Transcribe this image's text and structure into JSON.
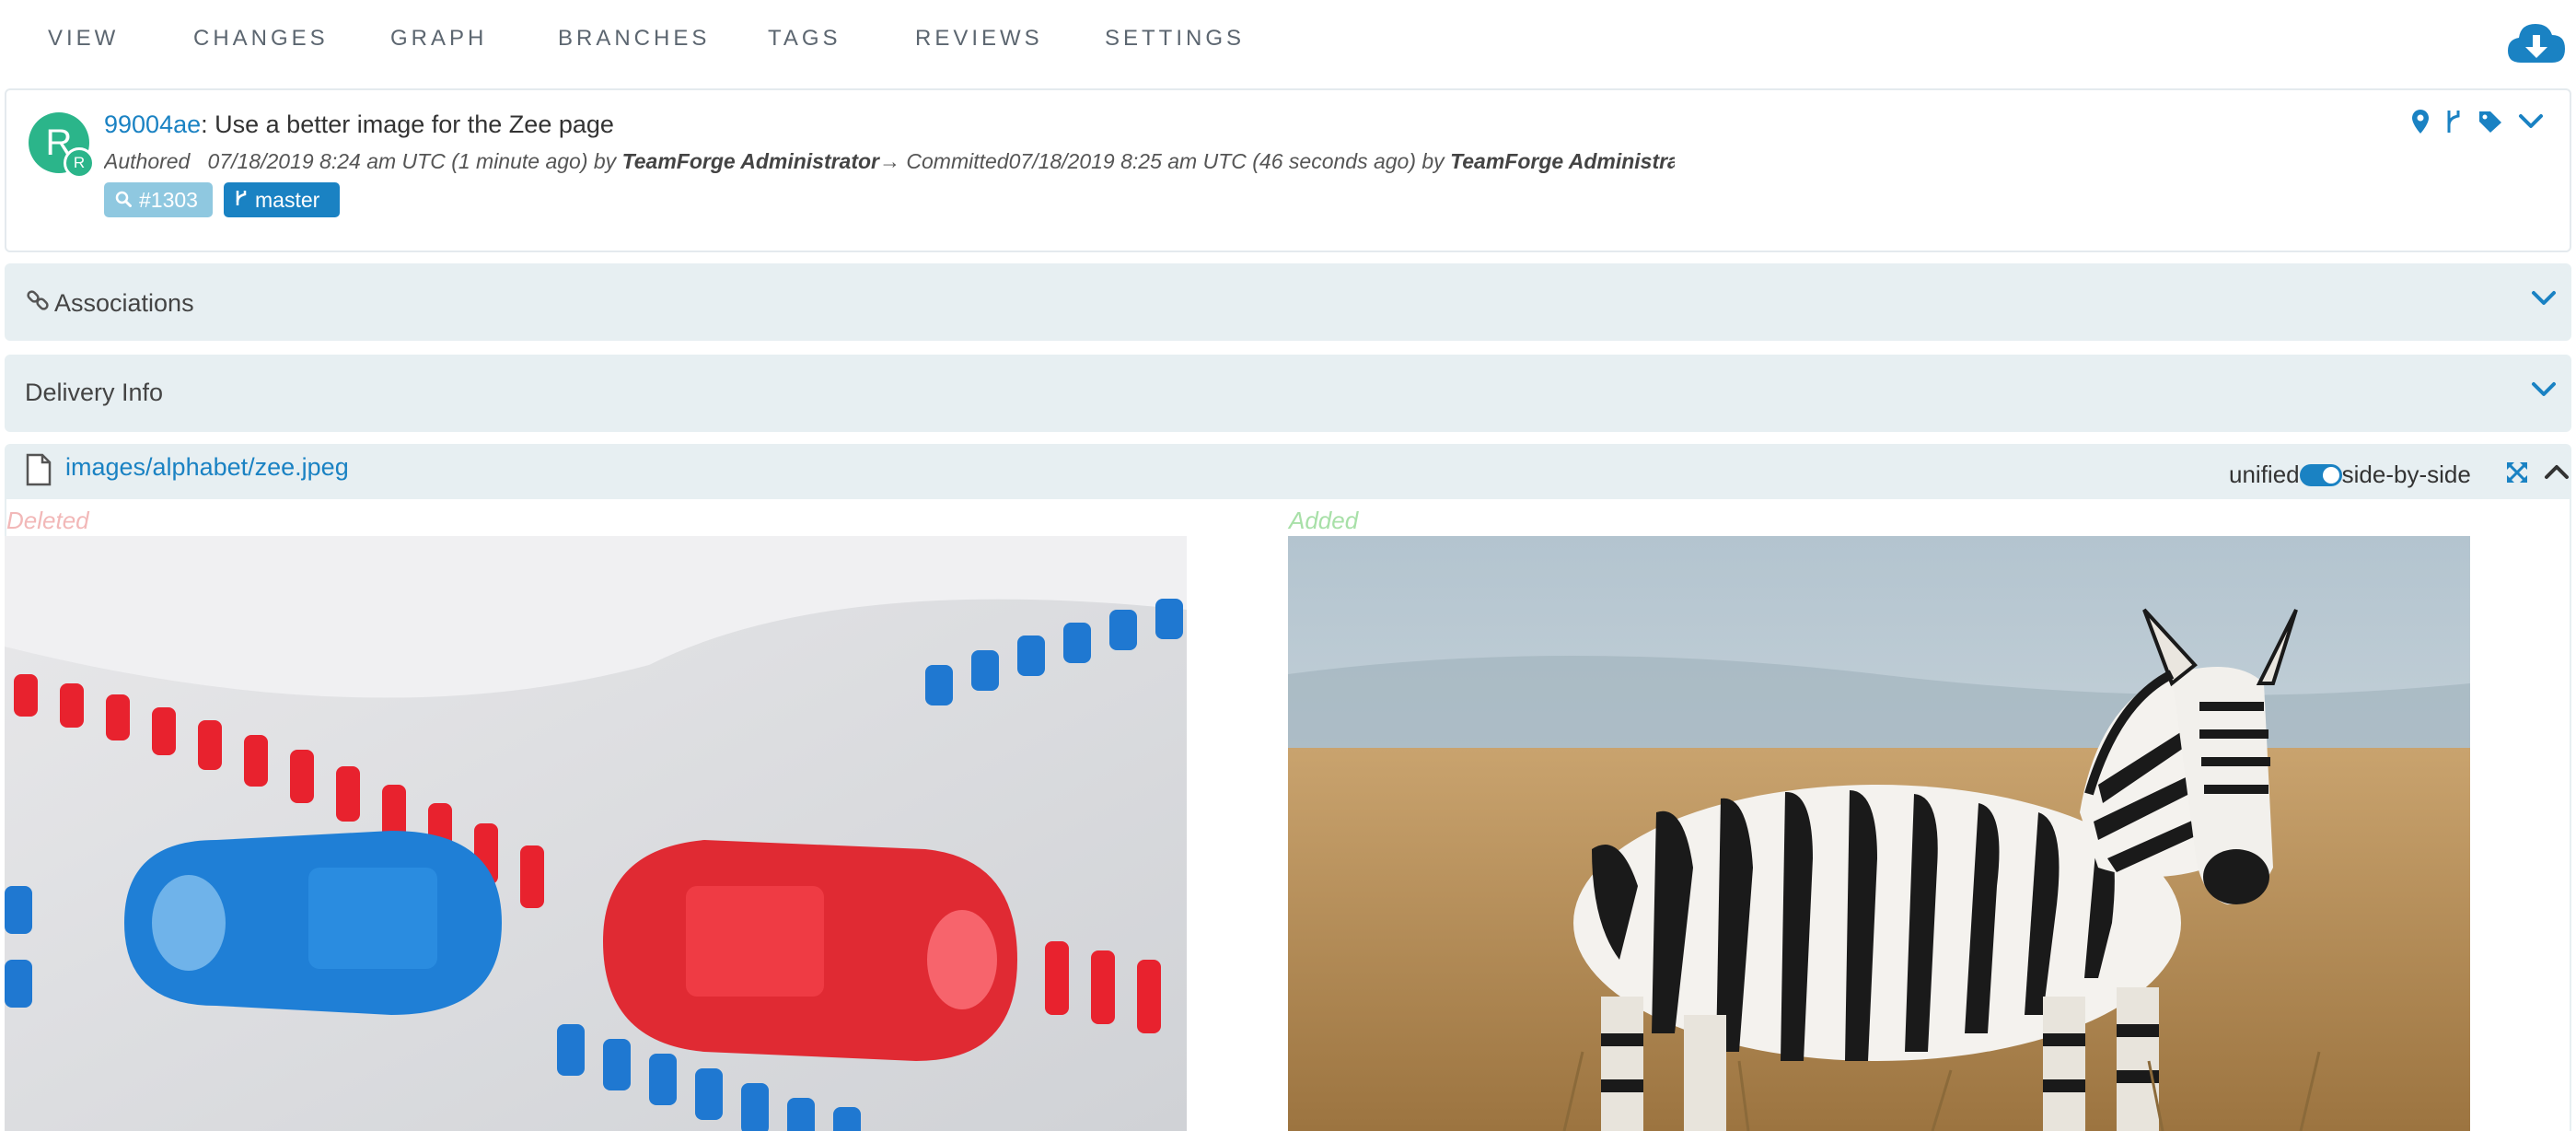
{
  "nav": {
    "items": [
      "VIEW",
      "CHANGES",
      "GRAPH",
      "BRANCHES",
      "TAGS",
      "REVIEWS",
      "SETTINGS"
    ],
    "download_icon": "cloud-download-icon"
  },
  "commit": {
    "avatar_initial": "R",
    "avatar_badge": "R",
    "hash": "99004ae",
    "separator": ":",
    "message": " Use a better image for the Zee page",
    "authored_label": "Authored",
    "authored_time": "07/18/2019 8:24 am UTC (1 minute ago) by",
    "author": "TeamForge Administrator",
    "arrow": "→",
    "committed_label": "Committed",
    "committed_time": "07/18/2019 8:25 am UTC (46 seconds ago) by",
    "committer": "TeamForge Administrator",
    "review_chip": "#1303",
    "branch_chip": "master"
  },
  "panels": {
    "associations": "Associations",
    "delivery": "Delivery Info"
  },
  "file": {
    "path": "images/alphabet/zee.jpeg",
    "toggle_left": "unified",
    "toggle_right": "side-by-side",
    "toggle_state": "side-by-side",
    "deleted_label": "Deleted",
    "added_label": "Added"
  },
  "colors": {
    "accent": "#1a82c3",
    "avatar": "#2bb58a",
    "panel_bg": "#e7eff2",
    "deleted": "#f2b8b8",
    "added": "#a8e0a8"
  }
}
